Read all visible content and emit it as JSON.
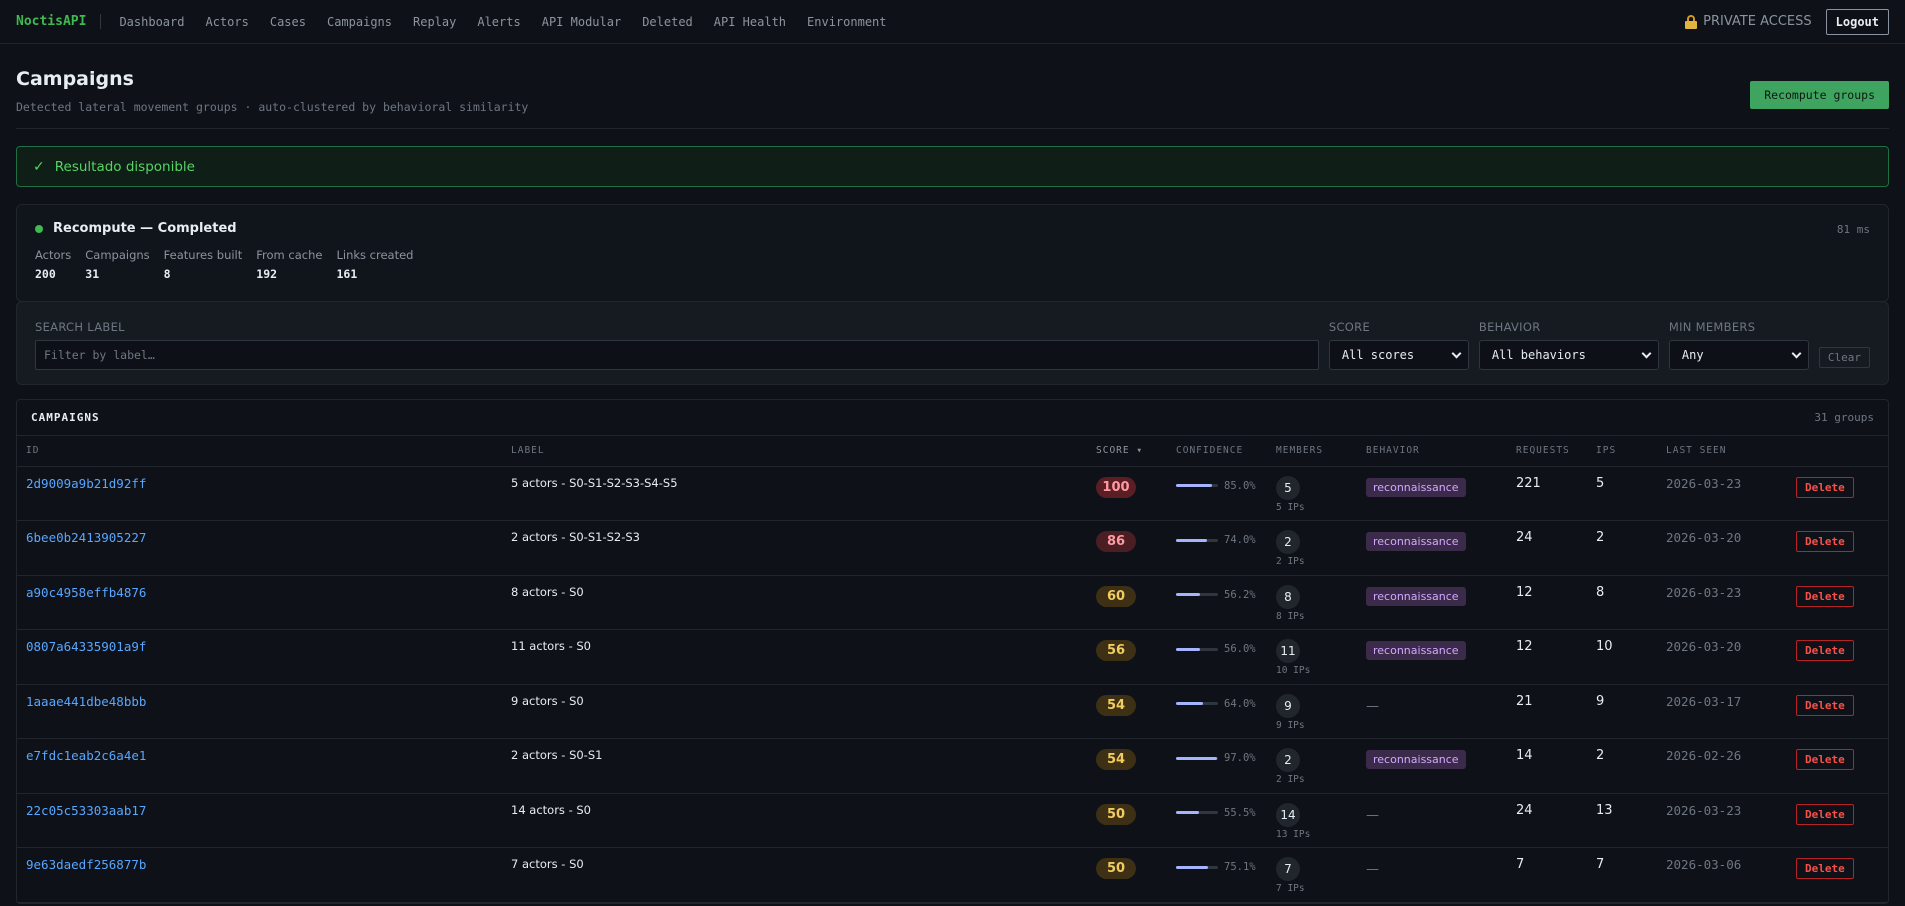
{
  "nav": {
    "brand": "NoctisAPI",
    "links": [
      "Dashboard",
      "Actors",
      "Cases",
      "Campaigns",
      "Replay",
      "Alerts",
      "API Modular",
      "Deleted",
      "API Health",
      "Environment"
    ],
    "private_access": "PRIVATE ACCESS",
    "logout": "Logout"
  },
  "header": {
    "title": "Campaigns",
    "subtitle": "Detected lateral movement groups · auto-clustered by behavioral similarity",
    "recompute_button": "Recompute groups"
  },
  "alert": {
    "icon": "✓",
    "text": "Resultado disponible"
  },
  "recompute": {
    "status": "Recompute — Completed",
    "duration": "81 ms",
    "stats": [
      {
        "label": "Actors",
        "value": "200"
      },
      {
        "label": "Campaigns",
        "value": "31"
      },
      {
        "label": "Features built",
        "value": "8"
      },
      {
        "label": "From cache",
        "value": "192"
      },
      {
        "label": "Links created",
        "value": "161"
      }
    ]
  },
  "filters": {
    "search_label": "SEARCH LABEL",
    "search_placeholder": "Filter by label…",
    "score_label": "SCORE",
    "score_value": "All scores",
    "behavior_label": "BEHAVIOR",
    "behavior_value": "All behaviors",
    "min_members_label": "MIN MEMBERS",
    "min_members_value": "Any",
    "clear": "Clear"
  },
  "campaigns_table": {
    "title": "CAMPAIGNS",
    "count": "31 groups",
    "columns": [
      "ID",
      "LABEL",
      "SCORE ▾",
      "CONFIDENCE",
      "MEMBERS",
      "BEHAVIOR",
      "REQUESTS",
      "IPS",
      "LAST SEEN",
      ""
    ],
    "rows": [
      {
        "id": "2d9009a9b21d92ff",
        "label": "5 actors - S0-S1-S2-S3-S4-S5",
        "score": "100",
        "confidence": "85.0%",
        "confidence_value": 0.85,
        "members": "5",
        "ips_label": "5 IPs",
        "behavior": "reconnaissance",
        "requests": "221",
        "ips": "5",
        "last_seen": "2026-03-23",
        "delete": "Delete",
        "score_bg": "#5a1e24",
        "score_fg": "#ff9aa2"
      },
      {
        "id": "6bee0b2413905227",
        "label": "2 actors - S0-S1-S2-S3",
        "score": "86",
        "confidence": "74.0%",
        "confidence_value": 0.74,
        "members": "2",
        "ips_label": "2 IPs",
        "behavior": "reconnaissance",
        "requests": "24",
        "ips": "2",
        "last_seen": "2026-03-20",
        "delete": "Delete",
        "score_bg": "#4a1e22",
        "score_fg": "#ff9aa2"
      },
      {
        "id": "a90c4958effb4876",
        "label": "8 actors - S0",
        "score": "60",
        "confidence": "56.2%",
        "confidence_value": 0.562,
        "members": "8",
        "ips_label": "8 IPs",
        "behavior": "reconnaissance",
        "requests": "12",
        "ips": "8",
        "last_seen": "2026-03-23",
        "delete": "Delete",
        "score_bg": "#3d3014",
        "score_fg": "#f2cc60"
      },
      {
        "id": "0807a64335901a9f",
        "label": "11 actors - S0",
        "score": "56",
        "confidence": "56.0%",
        "confidence_value": 0.56,
        "members": "11",
        "ips_label": "10 IPs",
        "behavior": "reconnaissance",
        "requests": "12",
        "ips": "10",
        "last_seen": "2026-03-20",
        "delete": "Delete",
        "score_bg": "#3d3014",
        "score_fg": "#f2cc60"
      },
      {
        "id": "1aaae441dbe48bbb",
        "label": "9 actors - S0",
        "score": "54",
        "confidence": "64.0%",
        "confidence_value": 0.64,
        "members": "9",
        "ips_label": "9 IPs",
        "behavior": "—",
        "requests": "21",
        "ips": "9",
        "last_seen": "2026-03-17",
        "delete": "Delete",
        "score_bg": "#3d3014",
        "score_fg": "#f2cc60"
      },
      {
        "id": "e7fdc1eab2c6a4e1",
        "label": "2 actors - S0-S1",
        "score": "54",
        "confidence": "97.0%",
        "confidence_value": 0.97,
        "members": "2",
        "ips_label": "2 IPs",
        "behavior": "reconnaissance",
        "requests": "14",
        "ips": "2",
        "last_seen": "2026-02-26",
        "delete": "Delete",
        "score_bg": "#3d3014",
        "score_fg": "#f2cc60"
      },
      {
        "id": "22c05c53303aab17",
        "label": "14 actors - S0",
        "score": "50",
        "confidence": "55.5%",
        "confidence_value": 0.555,
        "members": "14",
        "ips_label": "13 IPs",
        "behavior": "—",
        "requests": "24",
        "ips": "13",
        "last_seen": "2026-03-23",
        "delete": "Delete",
        "score_bg": "#3d3014",
        "score_fg": "#f2cc60"
      },
      {
        "id": "9e63daedf256877b",
        "label": "7 actors - S0",
        "score": "50",
        "confidence": "75.1%",
        "confidence_value": 0.751,
        "members": "7",
        "ips_label": "7 IPs",
        "behavior": "—",
        "requests": "7",
        "ips": "7",
        "last_seen": "2026-03-06",
        "delete": "Delete",
        "score_bg": "#3d3014",
        "score_fg": "#f2cc60"
      }
    ]
  }
}
